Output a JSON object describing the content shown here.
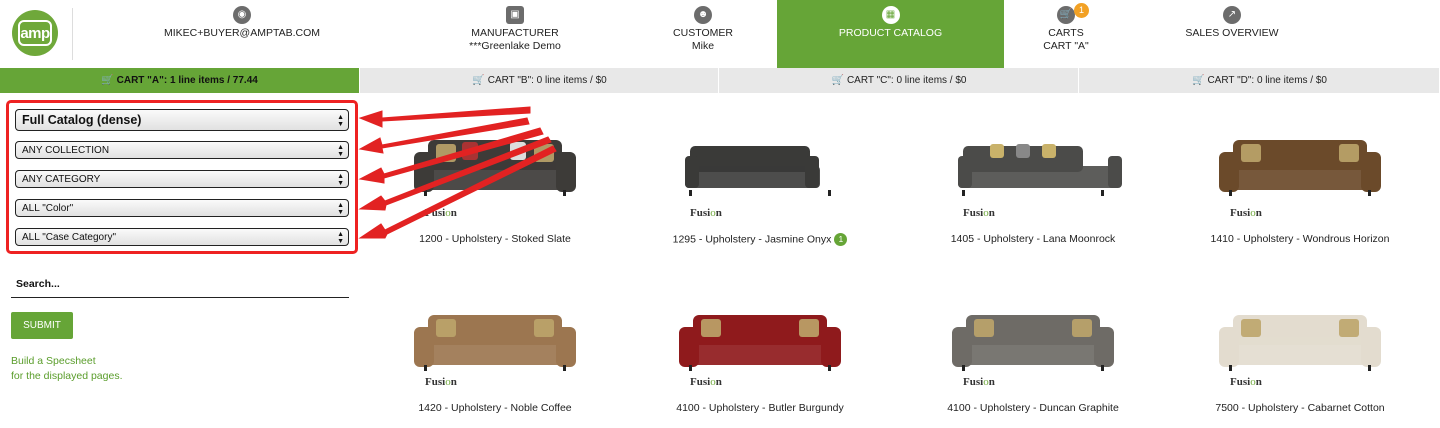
{
  "colors": {
    "brand_green": "#66a537",
    "badge_orange": "#f2a125",
    "annotation_red": "#e22222",
    "link_green": "#5a9d2b"
  },
  "logo": {
    "text": "amp"
  },
  "nav": {
    "user": {
      "icon": "lock-icon",
      "line1": "MIKEC+BUYER@AMPTAB.COM"
    },
    "manufacturer": {
      "icon": "factory-icon",
      "line1": "MANUFACTURER",
      "line2": "***Greenlake Demo"
    },
    "customer": {
      "icon": "users-icon",
      "line1": "CUSTOMER",
      "line2": "Mike"
    },
    "catalog": {
      "icon": "grid-icon",
      "line1": "PRODUCT CATALOG"
    },
    "carts": {
      "icon": "cart-icon",
      "line1": "CARTS",
      "line2": "CART \"A\"",
      "badge": "1"
    },
    "sales": {
      "icon": "chart-line-icon",
      "line1": "SALES OVERVIEW"
    }
  },
  "carts": [
    {
      "label": "CART \"A\":  1 line items / 77.44"
    },
    {
      "label": "CART \"B\":  0 line items / $0"
    },
    {
      "label": "CART \"C\":  0 line items / $0"
    },
    {
      "label": "CART \"D\":  0 line items / $0"
    }
  ],
  "filters": {
    "catalog": "Full Catalog (dense)",
    "collection": "ANY COLLECTION",
    "category": "ANY CATEGORY",
    "color": "ALL \"Color\"",
    "case_category": "ALL \"Case Category\""
  },
  "search": {
    "placeholder": "Search..."
  },
  "submit_label": "SUBMIT",
  "specsheet": {
    "line1": "Build a Specsheet",
    "line2": "for the displayed pages."
  },
  "brand": {
    "prefix": "Fusi",
    "mark": "o",
    "suffix": "n"
  },
  "products": [
    {
      "caption_a": "1200 - Upholstery - ",
      "caption_b": "Stoked Slate",
      "qty": "",
      "color": "#3d3b38"
    },
    {
      "caption_a": "1295 - Upholstery - ",
      "caption_b": "Jasmine Onyx",
      "qty": "1",
      "color": "#3a3a38"
    },
    {
      "caption_a": "1405 - Upholstery - ",
      "caption_b": "Lana Moonrock",
      "qty": "",
      "color": "#4b4b49"
    },
    {
      "caption_a": "1410 - Upholstery - ",
      "caption_b": "Wondrous Horizon",
      "qty": "",
      "color": "#6b4a2a"
    },
    {
      "caption_a": "1420 - Upholstery - ",
      "caption_b": "Noble Coffee",
      "qty": "",
      "color": "#9c7650"
    },
    {
      "caption_a": "4100 - Upholstery - ",
      "caption_b": "Butler Burgundy",
      "qty": "",
      "color": "#8f1a1c"
    },
    {
      "caption_a": "4100 - Upholstery - ",
      "caption_b": "Duncan Graphite",
      "qty": "",
      "color": "#6e6b66"
    },
    {
      "caption_a": "7500 - Upholstery - ",
      "caption_b": "Cabarnet Cotton",
      "qty": "",
      "color": "#e3dccf"
    }
  ]
}
